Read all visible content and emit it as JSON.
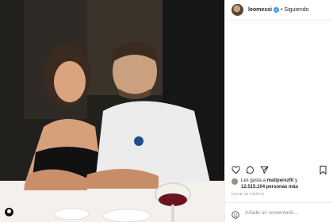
{
  "post": {
    "username": "leomessi",
    "separator": "•",
    "follow_status": "Siguiendo",
    "likes_prefix": "Les gusta a",
    "likes_user": "matiperezfit",
    "likes_conjunction": "y",
    "likes_count": "12.515.104 personas más",
    "timestamp": "HACE 15 HORAS",
    "comment_placeholder": "Añade un comentario..."
  },
  "icons": {
    "like": "heart-icon",
    "comment": "comment-icon",
    "share": "paper-plane-icon",
    "save": "bookmark-icon",
    "emoji": "smiley-icon",
    "verified": "verified-badge-icon"
  },
  "colors": {
    "verified": "#3897f0",
    "meta_text": "#8e8e8e",
    "primary_text": "#262626"
  }
}
